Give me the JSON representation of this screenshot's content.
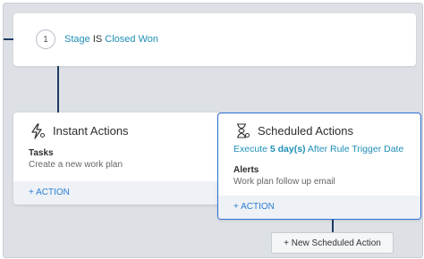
{
  "condition": {
    "step": "1",
    "field": "Stage",
    "operator": "IS",
    "value": "Closed Won"
  },
  "instant": {
    "title": "Instant Actions",
    "section_label": "Tasks",
    "section_text": "Create a new work plan",
    "action": "+ ACTION",
    "icon": "lightning-gear-icon"
  },
  "scheduled": {
    "title": "Scheduled Actions",
    "execute_prefix": "Execute",
    "execute_value": "5 day(s)",
    "execute_suffix": "After Rule Trigger Date",
    "section_label": "Alerts",
    "section_text": "Work plan follow up email",
    "action": "+ ACTION",
    "icon": "hourglass-gear-icon"
  },
  "new_scheduled_action": "+ New Scheduled Action",
  "colors": {
    "connector": "#1f3b63",
    "link": "#1f8fb8",
    "selected_border": "#2f6fd6"
  }
}
